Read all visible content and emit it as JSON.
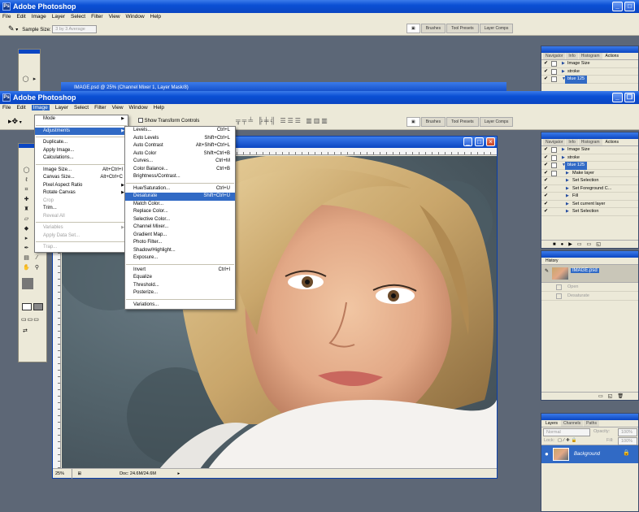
{
  "app": {
    "title": "Adobe Photoshop"
  },
  "menubar": [
    "File",
    "Edit",
    "Image",
    "Layer",
    "Select",
    "Filter",
    "View",
    "Window",
    "Help"
  ],
  "bg_options": {
    "sample_size_label": "Sample Size:",
    "sample_size_value": "3 by 3 Average"
  },
  "palette_tabs": [
    "Brushes",
    "Tool Presets",
    "Layer Comps"
  ],
  "bg_doc_title": "IMAGE.psd @ 25% (Channel Mixer 1, Layer Mask/8)",
  "main_options": {
    "show_transform_controls": "Show Transform Controls"
  },
  "image_menu": [
    {
      "label": "Mode",
      "submenu": true
    },
    {
      "sep": true
    },
    {
      "label": "Adjustments",
      "submenu": true,
      "highlight": true
    },
    {
      "sep": true
    },
    {
      "label": "Duplicate..."
    },
    {
      "label": "Apply Image..."
    },
    {
      "label": "Calculations..."
    },
    {
      "sep": true
    },
    {
      "label": "Image Size...",
      "shortcut": "Alt+Ctrl+I"
    },
    {
      "label": "Canvas Size...",
      "shortcut": "Alt+Ctrl+C"
    },
    {
      "label": "Pixel Aspect Ratio",
      "submenu": true
    },
    {
      "label": "Rotate Canvas",
      "submenu": true
    },
    {
      "label": "Crop",
      "disabled": true
    },
    {
      "label": "Trim..."
    },
    {
      "label": "Reveal All",
      "disabled": true
    },
    {
      "sep": true
    },
    {
      "label": "Variables",
      "submenu": true,
      "disabled": true
    },
    {
      "label": "Apply Data Set...",
      "disabled": true
    },
    {
      "sep": true
    },
    {
      "label": "Trap...",
      "disabled": true
    }
  ],
  "adjustments_menu": [
    {
      "label": "Levels...",
      "shortcut": "Ctrl+L"
    },
    {
      "label": "Auto Levels",
      "shortcut": "Shift+Ctrl+L"
    },
    {
      "label": "Auto Contrast",
      "shortcut": "Alt+Shift+Ctrl+L"
    },
    {
      "label": "Auto Color",
      "shortcut": "Shift+Ctrl+B"
    },
    {
      "label": "Curves...",
      "shortcut": "Ctrl+M"
    },
    {
      "label": "Color Balance...",
      "shortcut": "Ctrl+B"
    },
    {
      "label": "Brightness/Contrast..."
    },
    {
      "sep": true
    },
    {
      "label": "Hue/Saturation...",
      "shortcut": "Ctrl+U"
    },
    {
      "label": "Desaturate",
      "shortcut": "Shift+Ctrl+U",
      "highlight": true
    },
    {
      "label": "Match Color..."
    },
    {
      "label": "Replace Color..."
    },
    {
      "label": "Selective Color..."
    },
    {
      "label": "Channel Mixer..."
    },
    {
      "label": "Gradient Map..."
    },
    {
      "label": "Photo Filter..."
    },
    {
      "label": "Shadow/Highlight..."
    },
    {
      "label": "Exposure..."
    },
    {
      "sep": true
    },
    {
      "label": "Invert",
      "shortcut": "Ctrl+I"
    },
    {
      "label": "Equalize"
    },
    {
      "label": "Threshold..."
    },
    {
      "label": "Posterize..."
    },
    {
      "sep": true
    },
    {
      "label": "Variations..."
    }
  ],
  "actions_panel": {
    "tabs": [
      "Navigator",
      "Info",
      "Histogram",
      "Actions"
    ],
    "items": [
      {
        "label": "Image Size",
        "checked": true
      },
      {
        "label": "stroke",
        "checked": false
      },
      {
        "label": "blue 125",
        "checked": true,
        "selected": true
      },
      {
        "label": "Make layer",
        "checked": true
      },
      {
        "label": "Set Selection",
        "checked": true
      },
      {
        "label": "Set Foreground C...",
        "checked": true
      },
      {
        "label": "Fill",
        "checked": true
      },
      {
        "label": "Set current layer",
        "checked": true
      },
      {
        "label": "Set Selection",
        "checked": true
      }
    ]
  },
  "bg_actions_items": [
    "Image Size",
    "stroke",
    "blue 125"
  ],
  "history_panel": {
    "title": "History",
    "snapshot": "IMAGE.psd",
    "items": [
      "Open",
      "Desaturate"
    ]
  },
  "layers_panel": {
    "tabs": [
      "Layers",
      "Channels",
      "Paths"
    ],
    "blend_mode": "Normal",
    "opacity_label": "Opacity:",
    "opacity_value": "100%",
    "lock_label": "Lock:",
    "fill_label": "Fill:",
    "fill_value": "100%",
    "layer_name": "Background"
  },
  "status": {
    "zoom": "25%",
    "doc_info": "Doc: 24.6M/24.6M"
  },
  "colors": {
    "titlebar": "#0b46c2",
    "highlight": "#316ac5",
    "workspace": "#5d6776",
    "chrome": "#ece9d8"
  }
}
